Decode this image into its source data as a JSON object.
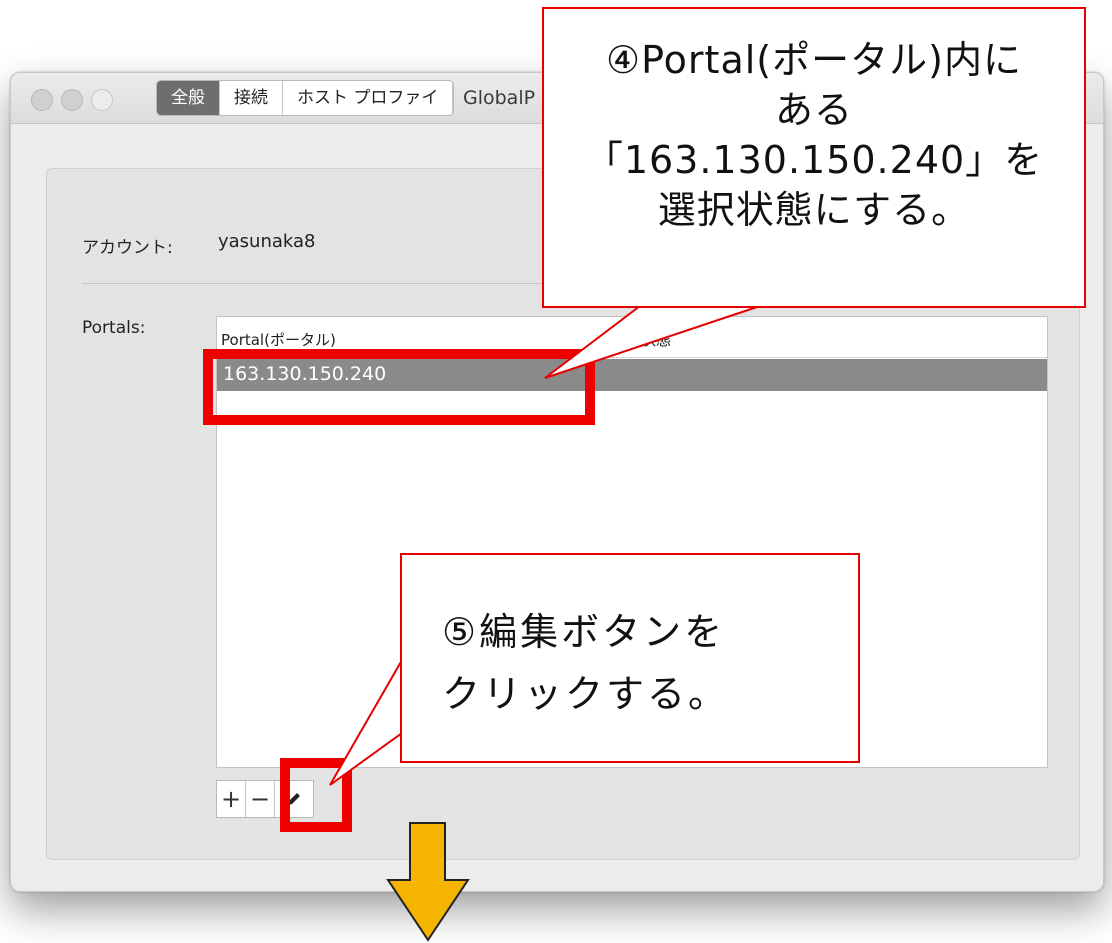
{
  "window": {
    "title": "GlobalP"
  },
  "tabs": [
    {
      "label": "全般",
      "active": true
    },
    {
      "label": "接続",
      "active": false
    },
    {
      "label": "ホスト プロファイ",
      "active": false
    }
  ],
  "account": {
    "label": "アカウント:",
    "value": "yasunaka8"
  },
  "portals": {
    "label": "Portals:",
    "columns": [
      "Portal(ポータル)",
      "状態"
    ],
    "rows": [
      {
        "portal": "163.130.150.240",
        "selected": true
      }
    ]
  },
  "table_buttons": {
    "add": "+",
    "remove": "−",
    "edit_icon": "pencil-icon"
  },
  "callouts": {
    "step4": [
      "④Portal(ポータル)内に",
      "ある",
      "「163.130.150.240」を",
      "選択状態にする。"
    ],
    "step5": [
      "⑤編集ボタンを",
      "クリックする。"
    ]
  },
  "colors": {
    "highlight": "#ee0000",
    "arrow": "#f5b400",
    "selection": "#8a8a8a"
  }
}
